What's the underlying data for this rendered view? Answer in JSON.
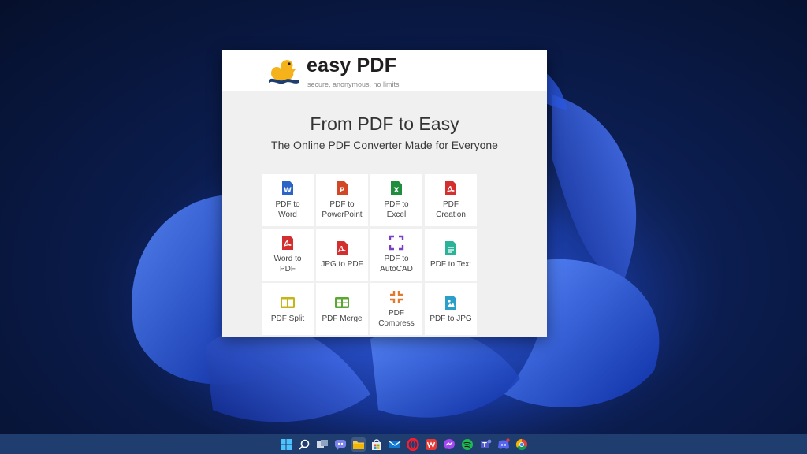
{
  "app": {
    "brand": "easy PDF",
    "tagline": "secure, anonymous, no limits"
  },
  "hero": {
    "title": "From PDF to Easy",
    "subtitle": "The Online PDF Converter Made for Everyone"
  },
  "tools": [
    {
      "label": "PDF to\nWord",
      "icon": "word-icon",
      "color": "#2b63c6"
    },
    {
      "label": "PDF to\nPowerPoint",
      "icon": "powerpoint-icon",
      "color": "#d24726"
    },
    {
      "label": "PDF to\nExcel",
      "icon": "excel-icon",
      "color": "#1e8e3e"
    },
    {
      "label": "PDF\nCreation",
      "icon": "pdf-icon",
      "color": "#d32f2f"
    },
    {
      "label": "Word to\nPDF",
      "icon": "pdf-icon",
      "color": "#d32f2f"
    },
    {
      "label": "JPG to PDF",
      "icon": "pdf-icon",
      "color": "#d32f2f"
    },
    {
      "label": "PDF to\nAutoCAD",
      "icon": "autocad-icon",
      "color": "#7b3fc4"
    },
    {
      "label": "PDF to Text",
      "icon": "text-icon",
      "color": "#2bb39a"
    },
    {
      "label": "PDF Split",
      "icon": "split-icon",
      "color": "#c9b418"
    },
    {
      "label": "PDF Merge",
      "icon": "merge-icon",
      "color": "#5aa832"
    },
    {
      "label": "PDF\nCompress",
      "icon": "compress-icon",
      "color": "#e07a2e"
    },
    {
      "label": "PDF to JPG",
      "icon": "jpg-icon",
      "color": "#2a9fc9"
    }
  ],
  "taskbar": {
    "icons": [
      "windows-start-icon",
      "search-icon",
      "task-view-icon",
      "teams-chat-icon",
      "file-explorer-icon",
      "store-icon",
      "mail-icon",
      "opera-icon",
      "wps-icon",
      "messenger-icon",
      "spotify-icon",
      "teams-icon",
      "discord-icon",
      "chrome-icon"
    ]
  }
}
